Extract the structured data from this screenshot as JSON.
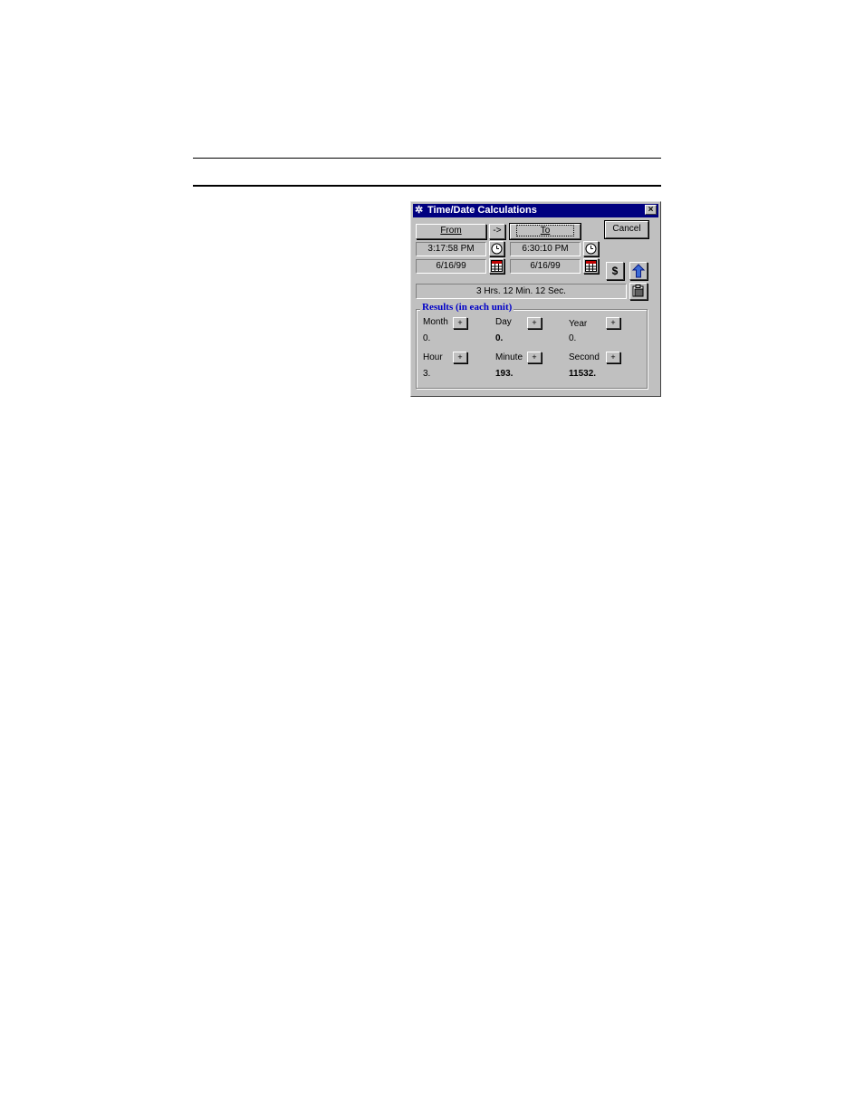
{
  "window": {
    "title": "Time/Date Calculations",
    "title_icon": "gear-icon",
    "close_glyph": "×"
  },
  "buttons": {
    "from": "From",
    "arrow": "->",
    "to": "To",
    "cancel": "Cancel",
    "dollar": "$"
  },
  "from": {
    "time": "3:17:58 PM",
    "date": "6/16/99"
  },
  "to": {
    "time": "6:30:10 PM",
    "date": "6/16/99"
  },
  "duration": "3 Hrs. 12 Min. 12 Sec.",
  "results": {
    "title": "Results (in each unit)",
    "plus": "+",
    "units": [
      {
        "label": "Month",
        "value": "0."
      },
      {
        "label": "Day",
        "value": "0."
      },
      {
        "label": "Year",
        "value": "0."
      },
      {
        "label": "Hour",
        "value": "3."
      },
      {
        "label": "Minute",
        "value": "193."
      },
      {
        "label": "Second",
        "value": "11532."
      }
    ]
  },
  "colors": {
    "titlebar": "#000080",
    "group_title": "#0000c8",
    "face": "#c0c0c0"
  }
}
